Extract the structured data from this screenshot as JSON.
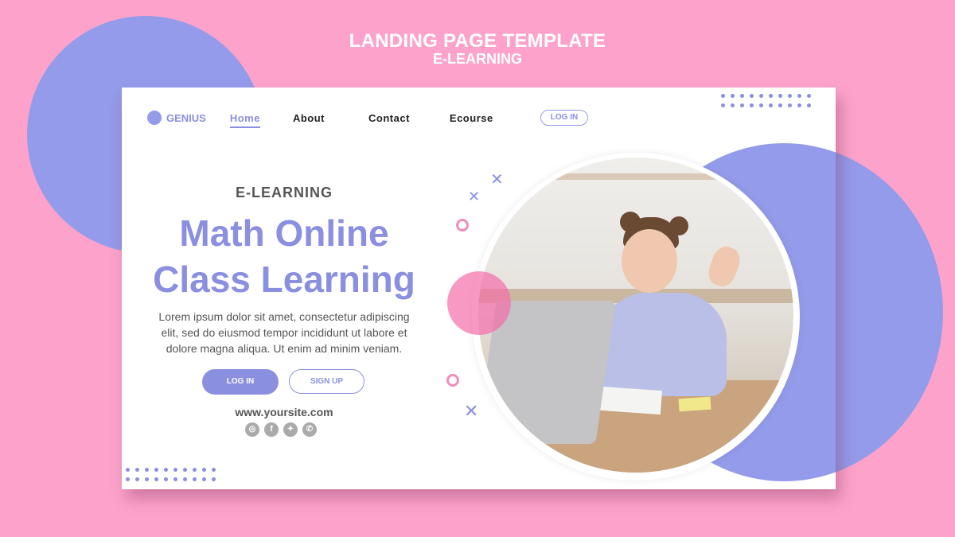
{
  "header": {
    "title": "LANDING PAGE TEMPLATE",
    "subtitle": "E-LEARNING"
  },
  "nav": {
    "logo": "GENIUS",
    "items": [
      {
        "label": "Home",
        "active": true
      },
      {
        "label": "About"
      },
      {
        "label": "Contact"
      },
      {
        "label": "Ecourse"
      }
    ],
    "login": "LOG IN"
  },
  "hero": {
    "eyebrow": "E-LEARNING",
    "headline_line1": "Math Online",
    "headline_line2": "Class Learning",
    "paragraph_line1": "Lorem ipsum dolor sit amet, consectetur adipiscing",
    "paragraph_line2": "elit, sed do eiusmod tempor incididunt ut labore et",
    "paragraph_line3": "dolore magna aliqua. Ut enim ad minim veniam.",
    "login_button": "LOG IN",
    "signup_button": "SIGN UP",
    "website": "www.yoursite.com",
    "socials": [
      {
        "icon": "instagram-icon",
        "glyph": "◎"
      },
      {
        "icon": "facebook-icon",
        "glyph": "f"
      },
      {
        "icon": "twitter-icon",
        "glyph": "✦"
      },
      {
        "icon": "whatsapp-icon",
        "glyph": "✆"
      }
    ]
  },
  "photo": {
    "description": "girl waving at laptop in kitchen"
  },
  "colors": {
    "background": "#fda3cb",
    "accent": "#949bea",
    "accent_text": "#8a8fe0",
    "pink": "#f56eaa"
  }
}
